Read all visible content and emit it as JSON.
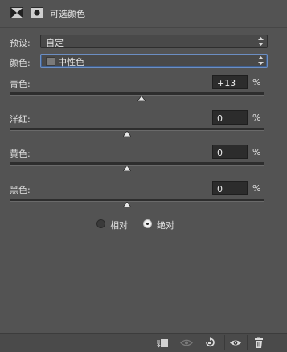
{
  "header": {
    "title": "可选颜色",
    "mask_icon": "pixel-mask-icon",
    "layer_icon": "layer-mask-icon"
  },
  "preset": {
    "label": "预设:",
    "value": "自定"
  },
  "colors": {
    "label": "颜色:",
    "value": "中性色",
    "swatch_color": "#7a7a7a"
  },
  "sliders": [
    {
      "label": "青色:",
      "value": "+13",
      "unit": "%",
      "level_percent": 13
    },
    {
      "label": "洋红:",
      "value": "0",
      "unit": "%",
      "level_percent": 0
    },
    {
      "label": "黄色:",
      "value": "0",
      "unit": "%",
      "level_percent": 0
    },
    {
      "label": "黑色:",
      "value": "0",
      "unit": "%",
      "level_percent": 0
    }
  ],
  "method": {
    "relative_label": "相对",
    "absolute_label": "绝对",
    "selected": "absolute"
  },
  "bottom_bar": {
    "icons": [
      "clip-to-layer-icon",
      "view-previous-icon",
      "reset-icon",
      "visibility-eye-icon",
      "trash-icon"
    ]
  }
}
